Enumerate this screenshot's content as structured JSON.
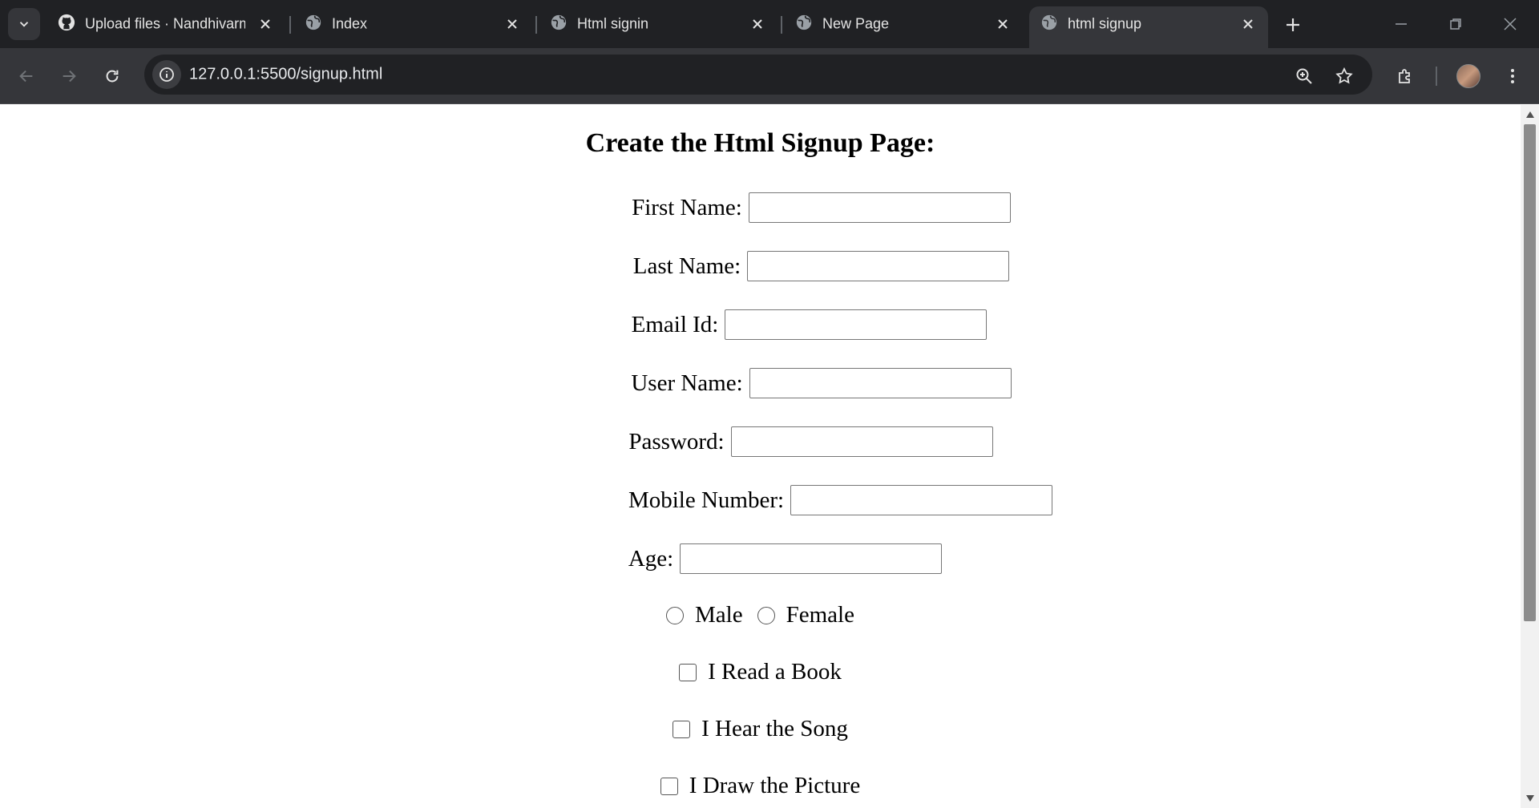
{
  "browser": {
    "tabs": [
      {
        "title": "Upload files · Nandhivarm",
        "icon": "github-icon"
      },
      {
        "title": "Index",
        "icon": "globe-icon"
      },
      {
        "title": "Html signin",
        "icon": "globe-icon"
      },
      {
        "title": "New Page",
        "icon": "globe-icon"
      },
      {
        "title": "html signup",
        "icon": "globe-icon",
        "active": true
      }
    ],
    "url": "127.0.0.1:5500/signup.html"
  },
  "page": {
    "title": "Create the Html Signup Page:",
    "fields": [
      {
        "label": "First Name:",
        "value": ""
      },
      {
        "label": "Last Name:",
        "value": ""
      },
      {
        "label": "Email Id:",
        "value": ""
      },
      {
        "label": "User Name:",
        "value": ""
      },
      {
        "label": "Password:",
        "value": ""
      },
      {
        "label": "Mobile Number:",
        "value": ""
      },
      {
        "label": "Age:",
        "value": ""
      }
    ],
    "gender_options": [
      "Male",
      "Female"
    ],
    "hobbies": [
      "I Read a Book",
      "I Hear the Song",
      "I Draw the Picture"
    ]
  },
  "colors": {
    "tabstrip_bg": "#202124",
    "toolbar_bg": "#35363a",
    "page_bg": "#ffffff"
  }
}
